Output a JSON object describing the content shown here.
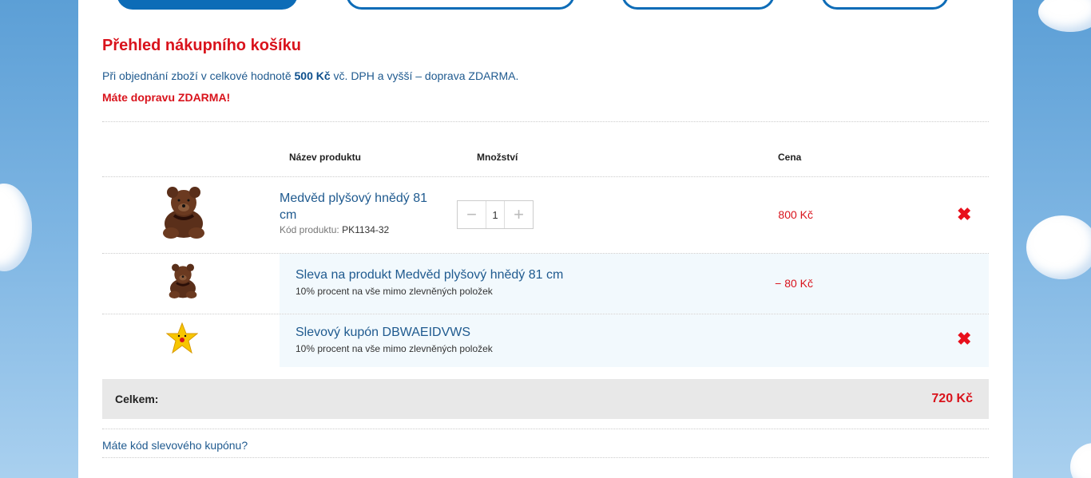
{
  "title": "Přehled nákupního košíku",
  "info": {
    "prefix": "Při objednání zboží v celkové hodnotě ",
    "amount": "500 Kč",
    "suffix": " vč. DPH a vyšší – doprava ZDARMA."
  },
  "free_shipping": "Máte dopravu ZDARMA!",
  "table": {
    "col_name": "Název produktu",
    "col_qty": "Množství",
    "col_price": "Cena"
  },
  "product": {
    "name": "Medvěd plyšový hnědý 81 cm",
    "code_label": "Kód produktu:",
    "code": "PK1134-32",
    "quantity": "1",
    "price": "800 Kč",
    "image": "brown-teddy-bear"
  },
  "discount": {
    "title": "Sleva na produkt Medvěd plyšový hnědý 81 cm",
    "desc": "10% procent na vše mimo zlevněných položek",
    "price": "− 80 Kč",
    "image": "brown-teddy-bear"
  },
  "coupon": {
    "title": "Slevový kupón DBWAEIDVWS",
    "desc": "10% procent na vše mimo zlevněných položek",
    "image": "yellow-star"
  },
  "total": {
    "label": "Celkem:",
    "value": "720 Kč"
  },
  "coupon_link": "Máte kód slevového kupónu?",
  "colors": {
    "accent_red": "#d9131c",
    "link_blue": "#1f5a8f",
    "brand_blue": "#0d6cb7"
  }
}
